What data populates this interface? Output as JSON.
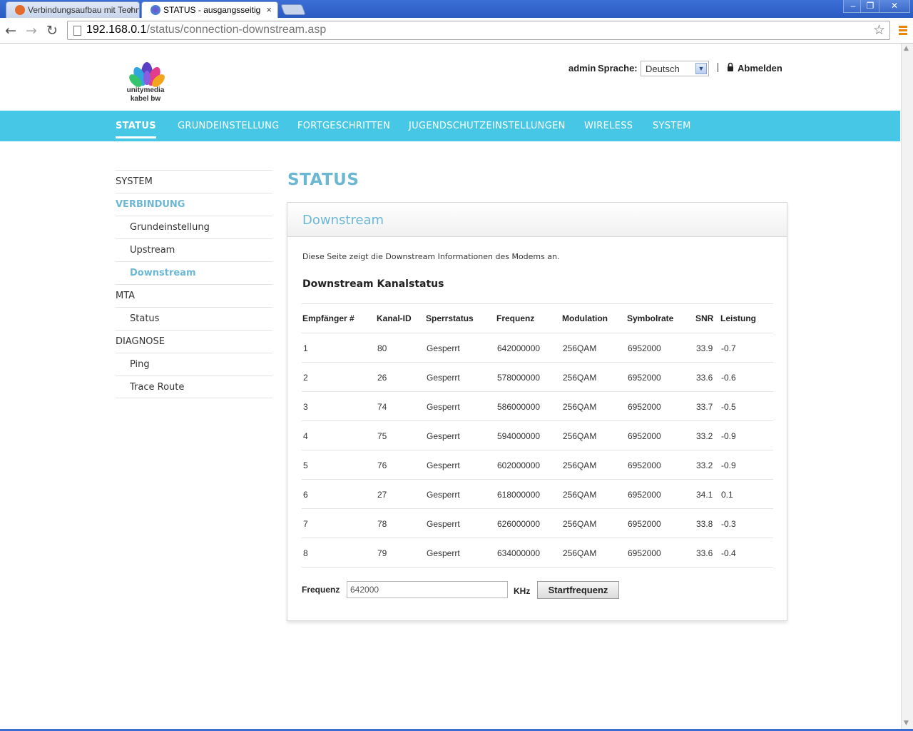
{
  "browser": {
    "tabs": [
      {
        "title": "Verbindungsaufbau mit Techn"
      },
      {
        "title": "STATUS - ausgangsseitig"
      }
    ],
    "tab_close": "×",
    "url_host": "192.168.0.1",
    "url_path": "/status/connection-downstream.asp",
    "window_controls": {
      "minimize": "–",
      "maximize": "❐",
      "close": "✕"
    }
  },
  "header": {
    "logo_line1": "unitymedia",
    "logo_line2": "kabel bw",
    "user": "admin",
    "language_label": "Sprache:",
    "language_value": "Deutsch",
    "logout": "Abmelden"
  },
  "mainnav": {
    "items": [
      {
        "label": "STATUS"
      },
      {
        "label": "GRUNDEINSTELLUNG"
      },
      {
        "label": "FORTGESCHRITTEN"
      },
      {
        "label": "JUGENDSCHUTZEINSTELLUNGEN"
      },
      {
        "label": "WIRELESS"
      },
      {
        "label": "SYSTEM"
      }
    ]
  },
  "sidebar": {
    "items": [
      {
        "label": "SYSTEM"
      },
      {
        "label": "VERBINDUNG"
      },
      {
        "label": "Grundeinstellung"
      },
      {
        "label": "Upstream"
      },
      {
        "label": "Downstream"
      },
      {
        "label": "MTA"
      },
      {
        "label": "Status"
      },
      {
        "label": "DIAGNOSE"
      },
      {
        "label": "Ping"
      },
      {
        "label": "Trace Route"
      }
    ]
  },
  "main": {
    "page_title": "STATUS",
    "panel_title": "Downstream",
    "description": "Diese Seite zeigt die Downstream Informationen des Modems an.",
    "section_title": "Downstream Kanalstatus",
    "table": {
      "headers": [
        "Empfänger #",
        "Kanal-ID",
        "Sperrstatus",
        "Frequenz",
        "Modulation",
        "Symbolrate",
        "SNR",
        "Leistung"
      ],
      "rows": [
        [
          "1",
          "80",
          "Gesperrt",
          "642000000",
          "256QAM",
          "6952000",
          "33.9",
          "-0.7"
        ],
        [
          "2",
          "26",
          "Gesperrt",
          "578000000",
          "256QAM",
          "6952000",
          "33.6",
          "-0.6"
        ],
        [
          "3",
          "74",
          "Gesperrt",
          "586000000",
          "256QAM",
          "6952000",
          "33.7",
          "-0.5"
        ],
        [
          "4",
          "75",
          "Gesperrt",
          "594000000",
          "256QAM",
          "6952000",
          "33.2",
          "-0.9"
        ],
        [
          "5",
          "76",
          "Gesperrt",
          "602000000",
          "256QAM",
          "6952000",
          "33.2",
          "-0.9"
        ],
        [
          "6",
          "27",
          "Gesperrt",
          "618000000",
          "256QAM",
          "6952000",
          "34.1",
          "0.1"
        ],
        [
          "7",
          "78",
          "Gesperrt",
          "626000000",
          "256QAM",
          "6952000",
          "33.8",
          "-0.3"
        ],
        [
          "8",
          "79",
          "Gesperrt",
          "634000000",
          "256QAM",
          "6952000",
          "33.6",
          "-0.4"
        ]
      ]
    },
    "freq_label": "Frequenz",
    "freq_value": "642000",
    "freq_unit": "KHz",
    "start_button": "Startfrequenz"
  },
  "colors": {
    "nav_bar": "#47c7e6",
    "accent_text": "#6cb8d4"
  }
}
